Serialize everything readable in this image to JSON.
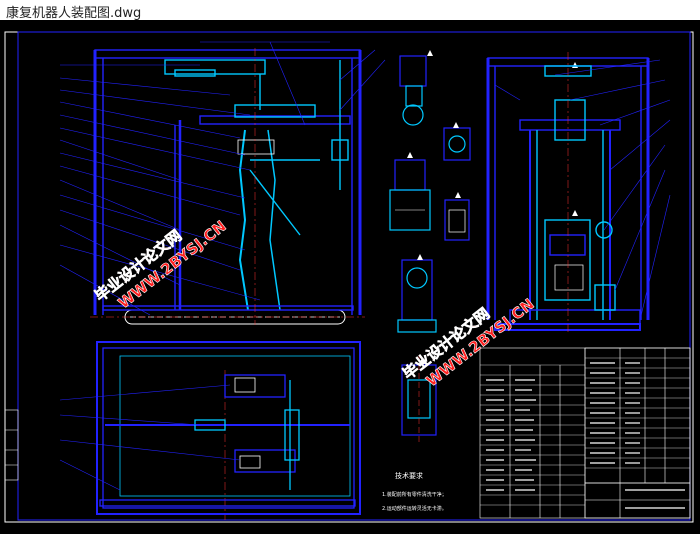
{
  "window": {
    "title": "康复机器人装配图.dwg"
  },
  "colors": {
    "background": "#000000",
    "line_blue": "#2222ff",
    "line_cyan": "#00c8ff",
    "line_white": "#ffffff",
    "line_yellow": "#ffff00",
    "line_green": "#33ff33",
    "watermark": "#ff2020"
  },
  "drawing": {
    "watermark_1": "毕业设计论文网",
    "watermark_1_url": "WWW.2BYSJ.CN",
    "watermark_2": "毕业设计论文网",
    "watermark_2_url": "WWW.2BYSJ.CN",
    "notes_title": "技术要求",
    "notes": [
      "1.装配前所有零件清洗干净；",
      "2.运动部件运转灵活无卡滞。"
    ]
  }
}
